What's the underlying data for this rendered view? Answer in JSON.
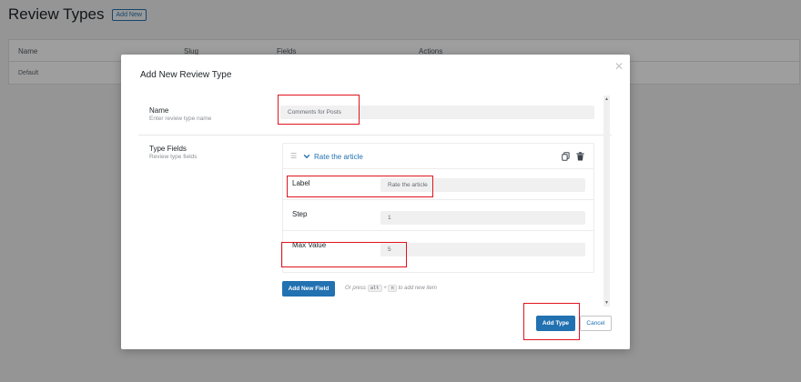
{
  "page": {
    "title": "Review Types",
    "add_new_label": "Add New",
    "columns": [
      "Name",
      "Slug",
      "Fields",
      "Actions"
    ],
    "rows": [
      {
        "name": "Default"
      }
    ]
  },
  "modal": {
    "title": "Add New Review Type",
    "close_glyph": "✕",
    "name_section": {
      "label": "Name",
      "description": "Enter review type name",
      "value": "Comments for Posts"
    },
    "type_fields_section": {
      "label": "Type Fields",
      "description": "Review type fields",
      "field": {
        "title": "Rate the article",
        "rows": [
          {
            "label": "Label",
            "value": "Rate the article"
          },
          {
            "label": "Step",
            "value": "1"
          },
          {
            "label": "Max Value",
            "value": "5"
          }
        ]
      }
    },
    "add_field_label": "Add New Field",
    "hint": {
      "prefix": "Or press",
      "key1": "alt",
      "plus": "+",
      "key2": "n",
      "suffix": "to add new item"
    },
    "add_type_label": "Add Type",
    "cancel_label": "Cancel"
  },
  "colors": {
    "accent": "#2271b1",
    "highlight": "#e0141e"
  },
  "icons": [
    "drag-handle-icon",
    "chevron-down-icon",
    "copy-icon",
    "trash-icon",
    "close-icon"
  ]
}
